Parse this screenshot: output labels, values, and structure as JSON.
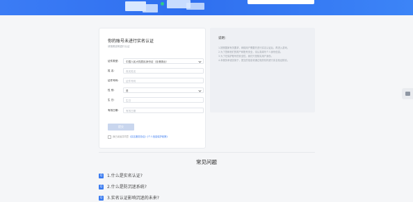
{
  "form": {
    "title": "你的账号未进行实名认证",
    "subtitle": "请按照说明进行认证",
    "rows": [
      {
        "label": "证件类型:",
        "value": "中国人民大陆居民身份证（含港澳台）",
        "is_placeholder": false,
        "dropdown": true
      },
      {
        "label": "姓    名:",
        "value": "真实姓名",
        "is_placeholder": true,
        "dropdown": false
      },
      {
        "label": "证件号码:",
        "value": "证件号码",
        "is_placeholder": true,
        "dropdown": false
      },
      {
        "label": "性    别:",
        "value": "男",
        "is_placeholder": false,
        "dropdown": true
      },
      {
        "label": "生    日:",
        "value": "生日",
        "is_placeholder": true,
        "dropdown": false
      },
      {
        "label": "有效日期:",
        "value": "有效日期",
        "is_placeholder": true,
        "dropdown": false
      }
    ],
    "submit_label": "提交",
    "agree_prefix": "我已阅读并同意",
    "agree_link1": "《实名服务协议》",
    "agree_link2": "《个人信息保护政策》"
  },
  "info": {
    "title": "说明：",
    "lines": [
      "1.按照国家有关要求，网络用户需要先进行实名认证后，再进入游戏。",
      "2.为了您和他们的财产和账号安全，请认真填写个人身份信息。",
      "3.为了在保护账号的安全性，我们只是核实用户身份。",
      "4.本服务承诺仅用于，提交的信息将通过相关机构进行实名验证核实。"
    ]
  },
  "faq": {
    "title": "常见问题",
    "items": [
      {
        "icon": "Q",
        "text": "1.什么是实名认证?"
      },
      {
        "icon": "Q",
        "text": "2.什么是防沉迷系统?"
      },
      {
        "icon": "Q",
        "text": "3.实名认证影响沉迷的未来?"
      }
    ]
  },
  "icons": {
    "side_button": "message-icon"
  },
  "colors": {
    "accent": "#3a7bf0",
    "hero": "#2f6fef"
  }
}
